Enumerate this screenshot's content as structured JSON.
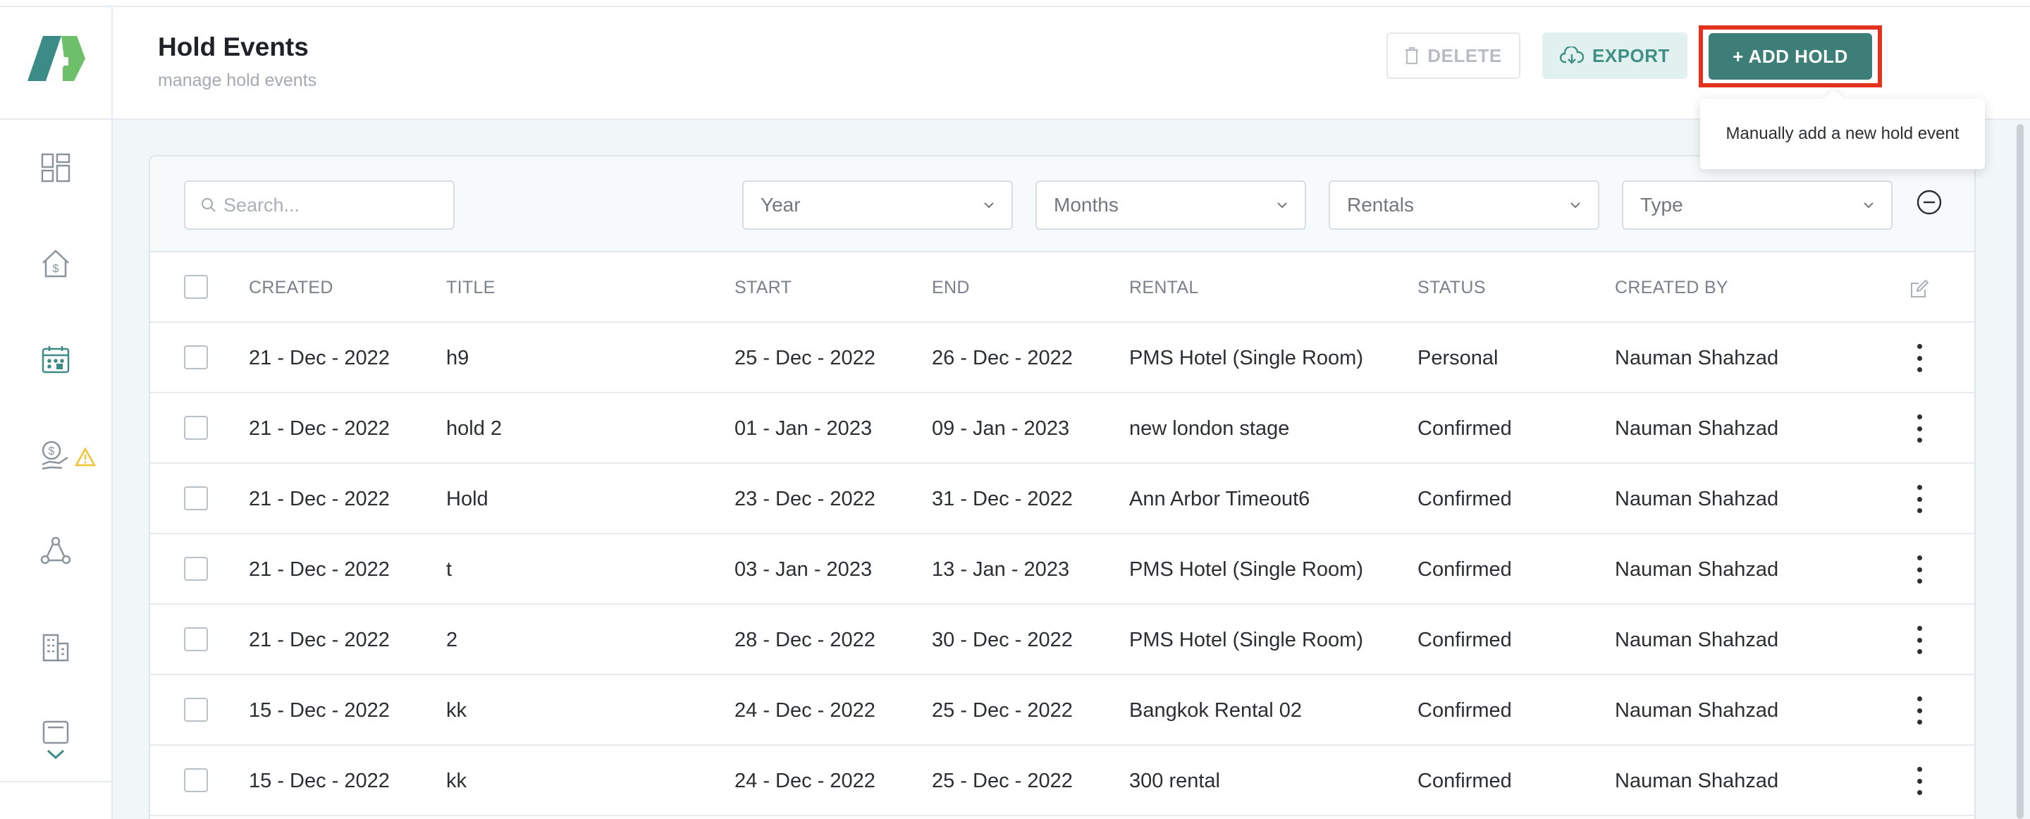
{
  "header": {
    "title": "Hold Events",
    "subtitle": "manage hold events",
    "delete_label": "DELETE",
    "export_label": "EXPORT",
    "add_label": "+ ADD HOLD",
    "tooltip": "Manually add a new hold event"
  },
  "sidebar": {
    "items": [
      {
        "icon": "dashboard-icon",
        "active": false
      },
      {
        "icon": "house-dollar-icon",
        "active": false
      },
      {
        "icon": "calendar-icon",
        "active": true
      },
      {
        "icon": "payment-icon",
        "active": false,
        "warning": "warning-icon"
      },
      {
        "icon": "network-icon",
        "active": false
      },
      {
        "icon": "building-icon",
        "active": false
      },
      {
        "icon": "document-icon",
        "active": false
      }
    ],
    "more_icon": "chevron-down-icon"
  },
  "filters": {
    "search_placeholder": "Search...",
    "year": "Year",
    "months": "Months",
    "rentals": "Rentals",
    "type": "Type"
  },
  "table": {
    "columns": [
      "CREATED",
      "TITLE",
      "START",
      "END",
      "RENTAL",
      "STATUS",
      "CREATED BY"
    ],
    "rows": [
      {
        "created": "21 - Dec - 2022",
        "title": "h9",
        "start": "25 - Dec - 2022",
        "end": "26 - Dec - 2022",
        "rental": "PMS Hotel (Single Room)",
        "status": "Personal",
        "created_by": "Nauman Shahzad"
      },
      {
        "created": "21 - Dec - 2022",
        "title": "hold 2",
        "start": "01 - Jan - 2023",
        "end": "09 - Jan - 2023",
        "rental": "new london stage",
        "status": "Confirmed",
        "created_by": "Nauman Shahzad"
      },
      {
        "created": "21 - Dec - 2022",
        "title": "Hold",
        "start": "23 - Dec - 2022",
        "end": "31 - Dec - 2022",
        "rental": "Ann Arbor Timeout6",
        "status": "Confirmed",
        "created_by": "Nauman Shahzad"
      },
      {
        "created": "21 - Dec - 2022",
        "title": "t",
        "start": "03 - Jan - 2023",
        "end": "13 - Jan - 2023",
        "rental": "PMS Hotel (Single Room)",
        "status": "Confirmed",
        "created_by": "Nauman Shahzad"
      },
      {
        "created": "21 - Dec - 2022",
        "title": "2",
        "start": "28 - Dec - 2022",
        "end": "30 - Dec - 2022",
        "rental": "PMS Hotel (Single Room)",
        "status": "Confirmed",
        "created_by": "Nauman Shahzad"
      },
      {
        "created": "15 - Dec - 2022",
        "title": "kk",
        "start": "24 - Dec - 2022",
        "end": "25 - Dec - 2022",
        "rental": "Bangkok Rental 02",
        "status": "Confirmed",
        "created_by": "Nauman Shahzad"
      },
      {
        "created": "15 - Dec - 2022",
        "title": "kk",
        "start": "24 - Dec - 2022",
        "end": "25 - Dec - 2022",
        "rental": "300 rental",
        "status": "Confirmed",
        "created_by": "Nauman Shahzad"
      }
    ]
  },
  "colors": {
    "accent": "#3d7f78",
    "highlight_border": "#e3321e",
    "warning": "#f2c230"
  }
}
